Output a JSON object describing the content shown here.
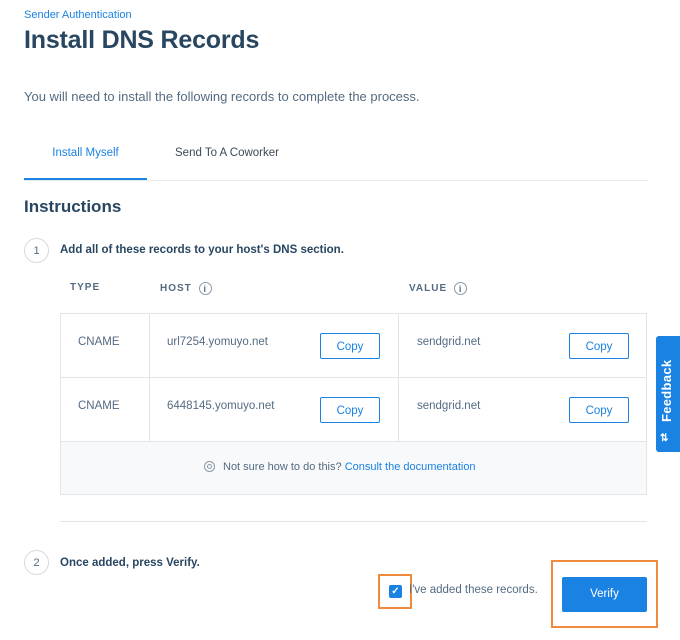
{
  "header": {
    "breadcrumb": "Sender Authentication",
    "title": "Install DNS Records",
    "subtitle": "You will need to install the following records to complete the process."
  },
  "tabs": [
    {
      "label": "Install Myself",
      "active": true
    },
    {
      "label": "Send To A Coworker",
      "active": false
    }
  ],
  "instructions": {
    "title": "Instructions",
    "step1": {
      "number": "1",
      "text": "Add all of these records to your host's DNS section."
    },
    "step2": {
      "number": "2",
      "text": "Once added, press Verify."
    }
  },
  "table": {
    "columns": {
      "type": "TYPE",
      "host": "HOST",
      "value": "VALUE"
    },
    "info_icon": "i",
    "rows": [
      {
        "type": "CNAME",
        "host": "url7254.yomuyo.net",
        "value": "sendgrid.net"
      },
      {
        "type": "CNAME",
        "host": "6448145.yomuyo.net",
        "value": "sendgrid.net"
      }
    ],
    "copy_label": "Copy",
    "help_text": "Not sure how to do this?",
    "help_link": "Consult the documentation"
  },
  "confirm": {
    "checkbox_checked": true,
    "checkbox_mark": "✓",
    "checkbox_label": "I've added these records.",
    "verify_label": "Verify"
  },
  "feedback": {
    "label": "Feedback",
    "icon": "⇅"
  },
  "colors": {
    "accent": "#1a82e2",
    "highlight": "#f08a3e",
    "text": "#294661"
  }
}
